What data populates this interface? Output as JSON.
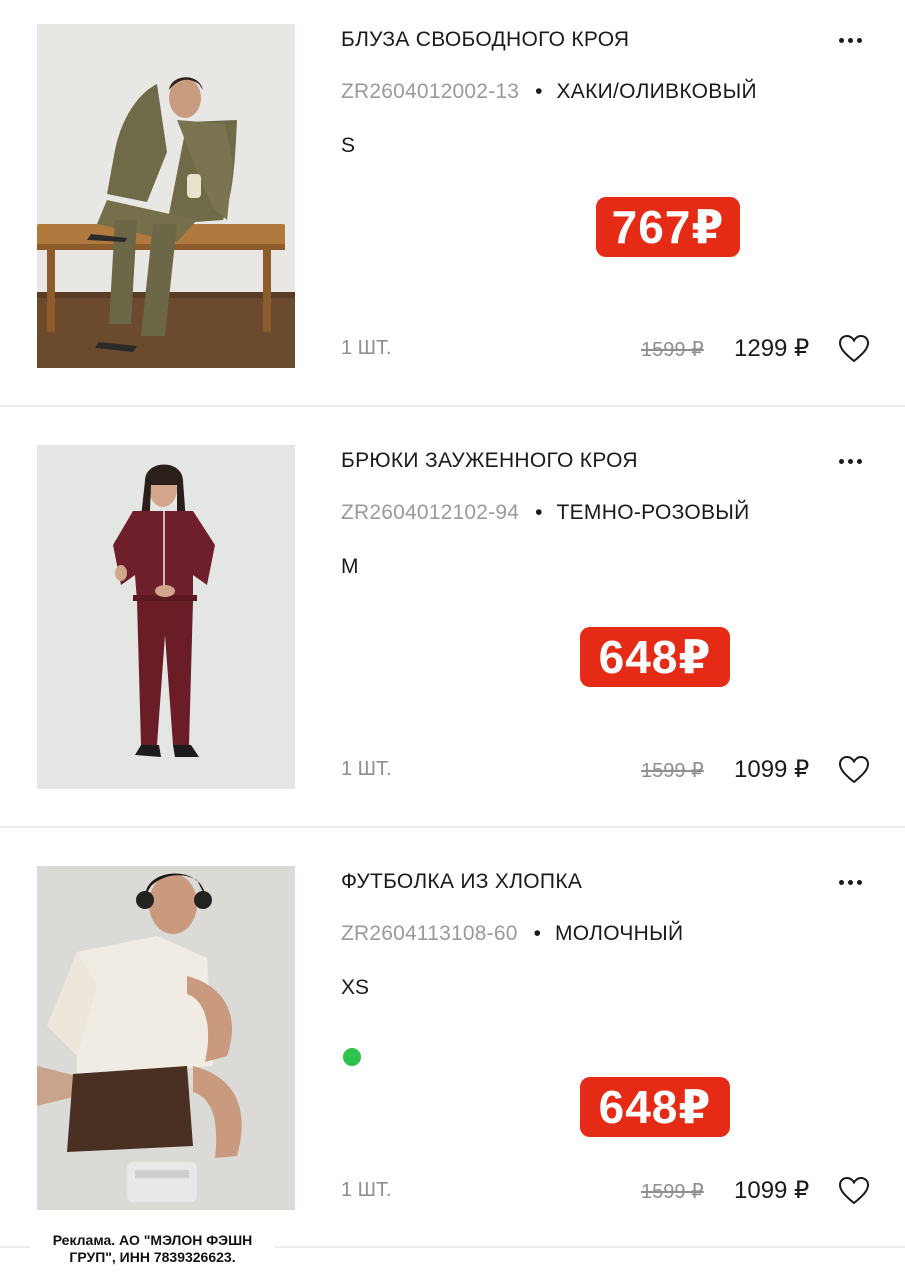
{
  "items": [
    {
      "name": "БЛУЗА СВОБОДНОГО КРОЯ",
      "sku": "ZR2604012002-13",
      "color": "ХАКИ/ОЛИВКОВЫЙ",
      "size": "S",
      "badge_price": "767₽",
      "quantity": "1 ШТ.",
      "old_price": "1599 ₽",
      "price": "1299 ₽"
    },
    {
      "name": "БРЮКИ ЗАУЖЕННОГО КРОЯ",
      "sku": "ZR2604012102-94",
      "color": "ТЕМНО-РОЗОВЫЙ",
      "size": "M",
      "badge_price": "648₽",
      "quantity": "1 ШТ.",
      "old_price": "1599 ₽",
      "price": "1099 ₽"
    },
    {
      "name": "ФУТБОЛКА ИЗ ХЛОПКА",
      "sku": "ZR2604113108-60",
      "color": "МОЛОЧНЫЙ",
      "size": "XS",
      "badge_price": "648₽",
      "quantity": "1 ШТ.",
      "old_price": "1599 ₽",
      "price": "1099 ₽",
      "status_indicator_color": "#2fc24d"
    }
  ],
  "separator": "•",
  "ad_disclaimer": "Реклама. АО \"МЭЛОН ФЭШН ГРУП\", ИНН 7839326623.",
  "colors": {
    "badge_bg": "#e52a16",
    "sku_text": "#9a9a9a",
    "old_price_text": "#8f8f8f"
  },
  "icons": {
    "more": "more-dots-icon",
    "favorite": "heart-outline-icon"
  }
}
